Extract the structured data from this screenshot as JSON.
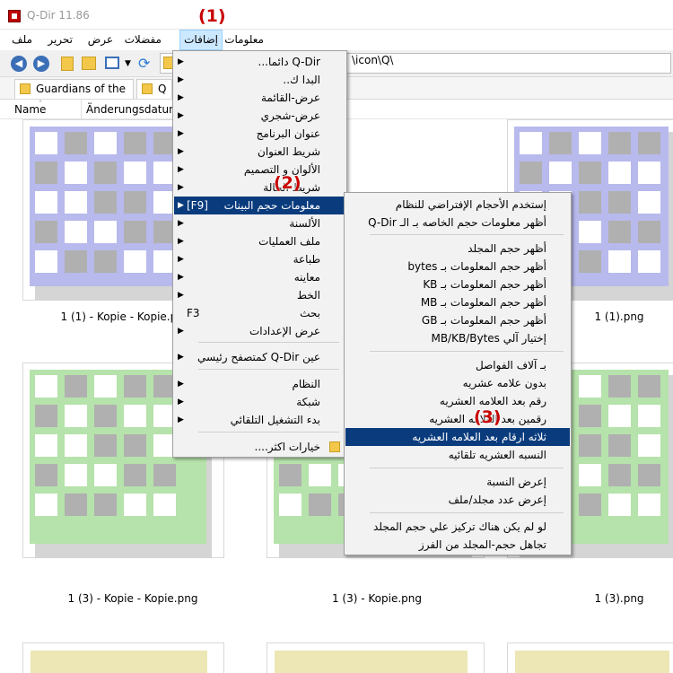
{
  "window": {
    "title": "Q-Dir 11.86"
  },
  "menubar": {
    "items": [
      {
        "label": "معلومات"
      },
      {
        "label": "إضافات"
      },
      {
        "label": "مفضلات"
      },
      {
        "label": "عرض"
      },
      {
        "label": "تحرير"
      },
      {
        "label": "ملف"
      }
    ]
  },
  "toolbar": {
    "back_icon": "back-arrow-icon",
    "forward_icon": "forward-arrow-icon",
    "refresh_icon": "refresh-icon",
    "address_value": "\\icon\\Q\\"
  },
  "tabs": [
    {
      "label": "Guardians of the ..."
    },
    {
      "label": "Q"
    }
  ],
  "columns": {
    "name": "Name",
    "date": "Änderungsdatum"
  },
  "thumbs": [
    {
      "caption": "1 (1) - Kopie - Kopie.png",
      "color": "#b8b9ec"
    },
    {
      "caption": "1 (1).png",
      "color": "#b8b9ec"
    },
    {
      "caption": "1 (3) - Kopie - Kopie.png",
      "color": "#b6e2ab"
    },
    {
      "caption": "1 (3) - Kopie.png",
      "color": "#b6e2ab"
    },
    {
      "caption": "1 (3).png",
      "color": "#b6e2ab"
    }
  ],
  "menu1": {
    "items": [
      {
        "label": "Q-Dir دائما...",
        "arrow": true
      },
      {
        "label": "البدا ك..",
        "arrow": true
      },
      {
        "label": "عرض-القائمة",
        "arrow": true
      },
      {
        "label": "عرض-شجري",
        "arrow": true
      },
      {
        "label": "عنوان البرنامج",
        "arrow": true
      },
      {
        "label": "شريط العنوان",
        "arrow": true
      },
      {
        "label": "الألوان و التصميم",
        "arrow": true
      },
      {
        "label": "شريط الحالة",
        "arrow": true
      },
      {
        "label": "معلومات حجم البينات",
        "accel": "[F9]",
        "arrow": true
      },
      {
        "label": "الألسنة",
        "arrow": true
      },
      {
        "label": "ملف العمليات",
        "arrow": true
      },
      {
        "label": "طباعة",
        "arrow": true
      },
      {
        "label": "معاينه",
        "arrow": true
      },
      {
        "label": "الخط",
        "arrow": true
      },
      {
        "label": "بحث",
        "accel": "F3"
      },
      {
        "label": "عرض الإعدادات",
        "arrow": true
      },
      {
        "label": "عين Q-Dir كمتصفح رئيسي",
        "arrow": true
      },
      {
        "label": "النظام",
        "arrow": true
      },
      {
        "label": "شبكة",
        "arrow": true
      },
      {
        "label": "بدء التشغيل التلقائي",
        "arrow": true
      },
      {
        "label": "خيارات اكثر...."
      }
    ]
  },
  "menu2": {
    "items": [
      {
        "label": "إستخدم الأحجام الإفتراضي للنظام"
      },
      {
        "label": "أظهر معلومات حجم الخاصه بـ الـ Q-Dir"
      },
      {
        "label": "أظهر حجم المجلد"
      },
      {
        "label": "أظهر حجم المعلومات بـ bytes"
      },
      {
        "label": "أظهر حجم المعلومات بـ KB"
      },
      {
        "label": "أظهر حجم المعلومات بـ MB"
      },
      {
        "label": "أظهر حجم المعلومات بـ GB"
      },
      {
        "label": "إختيار آلي MB/KB/Bytes"
      },
      {
        "label": "بـ آلاف الفواصل"
      },
      {
        "label": "بدون علامه عشريه"
      },
      {
        "label": "رقم بعد العلامه العشريه"
      },
      {
        "label": "رقمين بعد العلامه العشريه"
      },
      {
        "label": "ثلاثه ارقام بعد العلامه العشريه"
      },
      {
        "label": "النسبه العشريه تلقائيه"
      },
      {
        "label": "إعرض النسبة"
      },
      {
        "label": "إعرض عدد مجلد/ملف"
      },
      {
        "label": "لو لم يكن هناك تركيز علي حجم المجلد"
      },
      {
        "label": "تجاهل حجم-المجلد من الفرز"
      }
    ]
  },
  "callouts": {
    "c1": "(1)",
    "c2": "(2)",
    "c3": "(3)"
  }
}
